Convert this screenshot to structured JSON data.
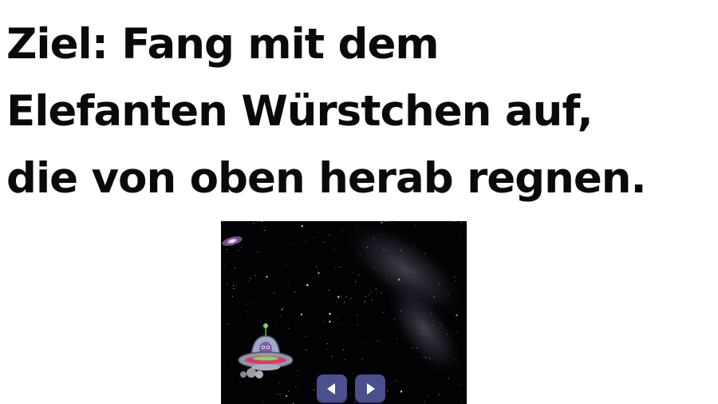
{
  "goal": {
    "lines": [
      "Ziel: Fang mit dem",
      "Elefanten Würstchen auf,",
      "die von oben herab regnen."
    ]
  },
  "stage": {
    "background": "#020204",
    "sprite": "ufo-alien-sprite",
    "decor": "galaxy-icon"
  },
  "controls": {
    "prev_icon": "triangle-left-icon",
    "next_icon": "triangle-right-icon",
    "button_color": "#4b4f8d"
  }
}
